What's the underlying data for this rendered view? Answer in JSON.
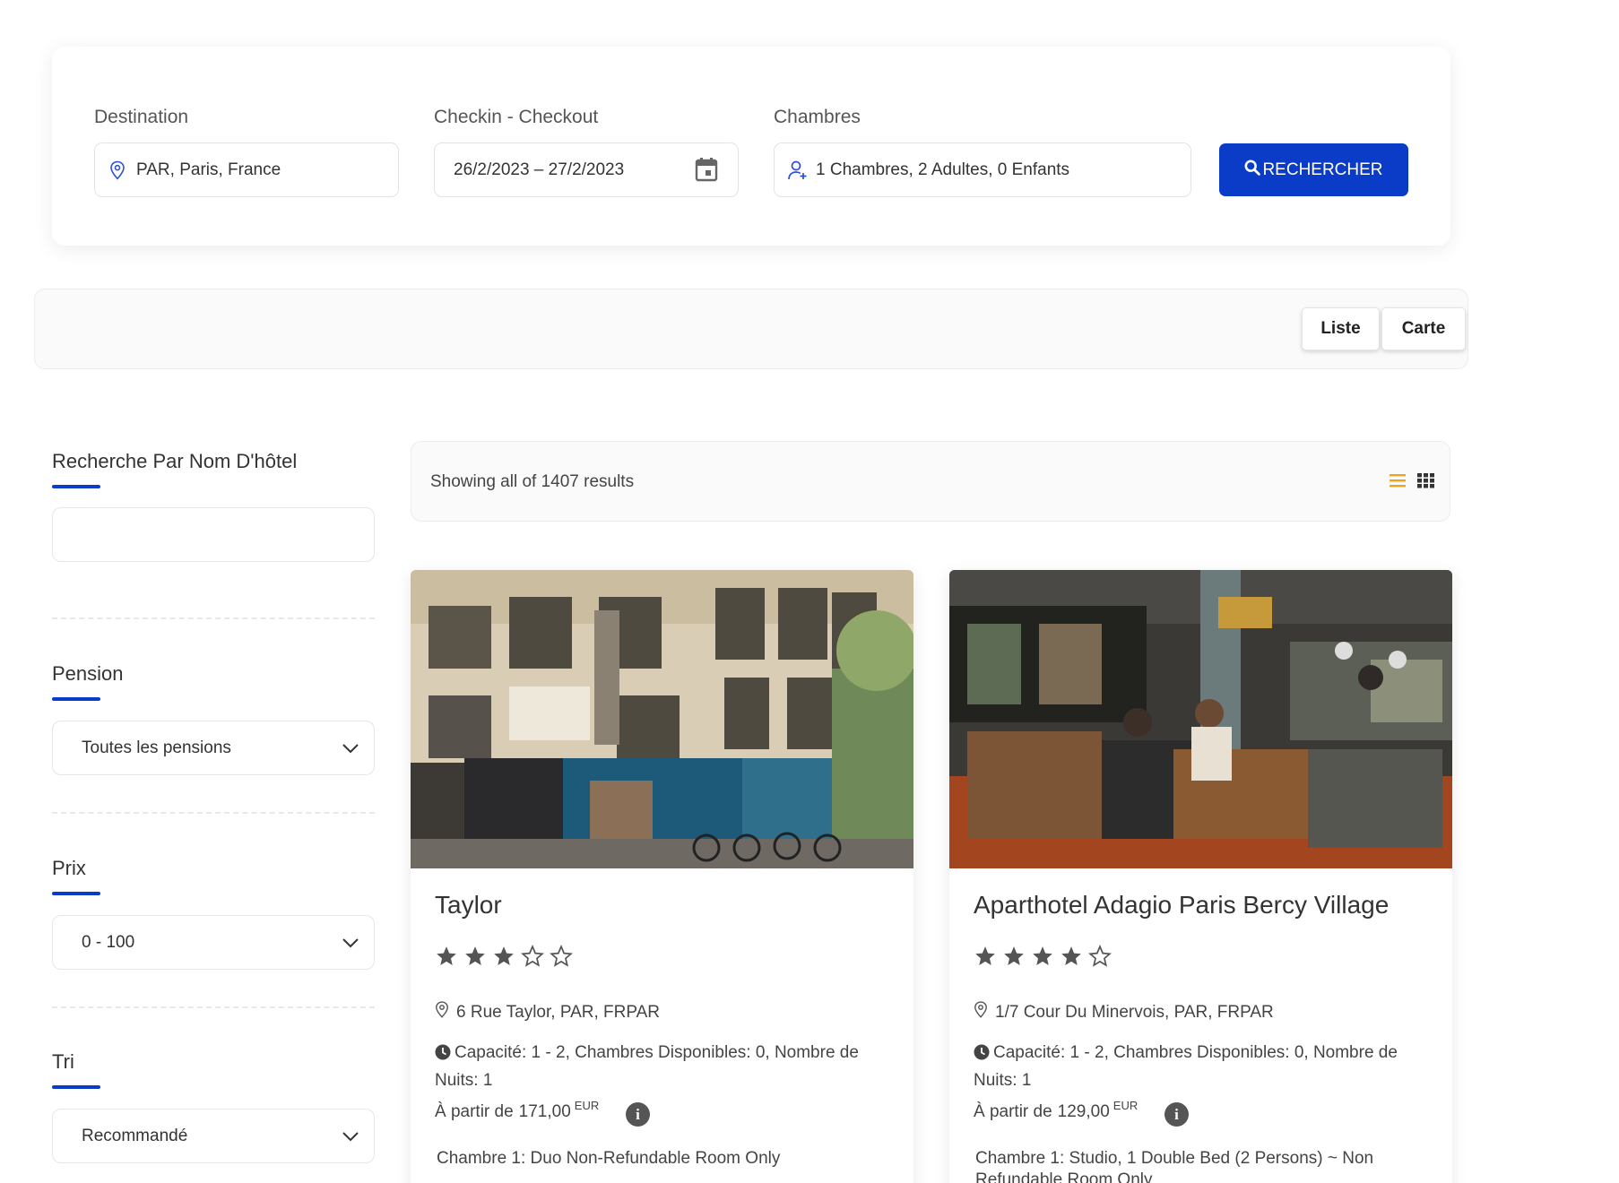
{
  "search": {
    "destination_label": "Destination",
    "destination_value": "PAR, Paris, France",
    "dates_label": "Checkin - Checkout",
    "dates_value": "26/2/2023 – 27/2/2023",
    "rooms_label": "Chambres",
    "rooms_value": "1 Chambres, 2 Adultes, 0 Enfants",
    "search_button": "RECHERCHER"
  },
  "view_toggle": {
    "list": "Liste",
    "map": "Carte"
  },
  "sidebar": {
    "name_search_title": "Recherche Par Nom D'hôtel",
    "name_search_value": "",
    "pension_title": "Pension",
    "pension_value": "Toutes les pensions",
    "price_title": "Prix",
    "price_value": "0 - 100",
    "sort_title": "Tri",
    "sort_value": "Recommandé"
  },
  "results": {
    "summary": "Showing all of 1407 results"
  },
  "hotels": [
    {
      "name": "Taylor",
      "stars": 3,
      "address": "6 Rue Taylor, PAR, FRPAR",
      "capacity": "Capacité: 1 - 2, Chambres Disponibles: 0, Nombre de Nuits: 1",
      "price_prefix": "À partir de",
      "price": "171,00",
      "currency": "EUR",
      "room": "Chambre 1: Duo Non-Refundable Room Only"
    },
    {
      "name": "Aparthotel Adagio Paris Bercy Village",
      "stars": 4,
      "address": "1/7 Cour Du Minervois, PAR, FRPAR",
      "capacity": "Capacité: 1 - 2, Chambres Disponibles: 0, Nombre de Nuits: 1",
      "price_prefix": "À partir de",
      "price": "129,00",
      "currency": "EUR",
      "room": "Chambre 1: Studio, 1 Double Bed (2 Persons) ~ Non Refundable Room Only"
    }
  ],
  "colors": {
    "accent": "#0a3cc8",
    "list_icon": "#f0a31c",
    "star": "#555555"
  },
  "icons": {
    "destination": "map-pin-icon",
    "dates": "calendar-icon",
    "rooms": "user-plus-icon",
    "search": "search-icon",
    "list_view": "list-view-icon",
    "grid_view": "grid-view-icon",
    "address": "map-pin-icon",
    "capacity": "clock-icon",
    "info": "info-icon",
    "dropdown": "chevron-down-icon"
  }
}
